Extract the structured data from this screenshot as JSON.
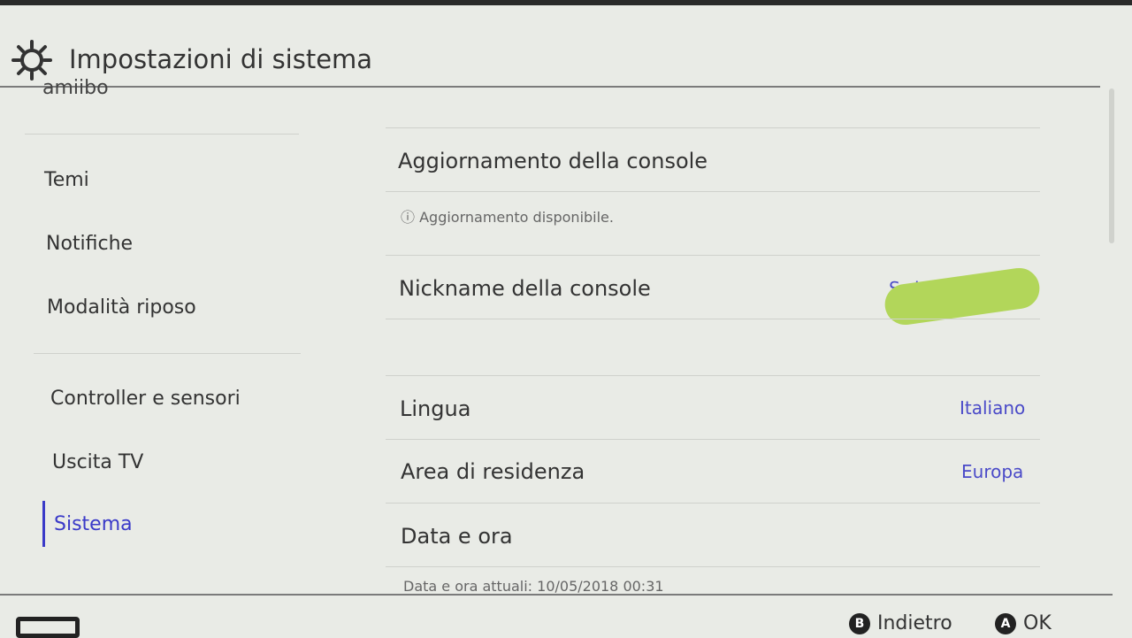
{
  "header": {
    "title": "Impostazioni di sistema",
    "icon": "gear-icon"
  },
  "sidebar": {
    "cut_item": "amiibo",
    "items": [
      {
        "label": "Temi"
      },
      {
        "label": "Notifiche"
      },
      {
        "label": "Modalità riposo"
      },
      {
        "label": "Controller e sensori"
      },
      {
        "label": "Uscita TV"
      },
      {
        "label": "Sistema",
        "active": true
      }
    ]
  },
  "main": {
    "update": {
      "label": "Aggiornamento della console",
      "note": "ⓘ Aggiornamento disponibile."
    },
    "nickname": {
      "label": "Nickname della console",
      "value": "Switch"
    },
    "language": {
      "label": "Lingua",
      "value": "Italiano"
    },
    "region": {
      "label": "Area di residenza",
      "value": "Europa"
    },
    "datetime": {
      "label": "Data e ora",
      "note": "Data e ora attuali: 10/05/2018 00:31"
    }
  },
  "footer": {
    "back_key": "B",
    "back_label": "Indietro",
    "ok_key": "A",
    "ok_label": "OK"
  },
  "colors": {
    "accent": "#3a3ac8",
    "background": "#e9ebe6"
  }
}
